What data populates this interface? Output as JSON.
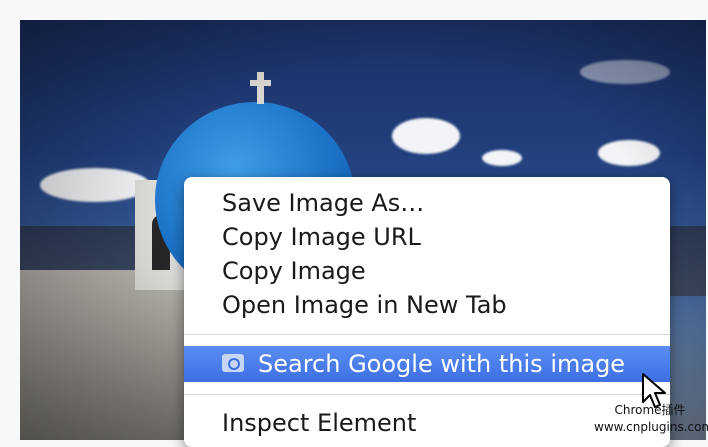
{
  "context_menu": {
    "items": [
      {
        "label": "Save Image As…"
      },
      {
        "label": "Copy Image URL"
      },
      {
        "label": "Copy Image"
      },
      {
        "label": "Open Image in New Tab"
      }
    ],
    "highlighted_item": {
      "label": "Search Google with this image",
      "icon": "camera-icon"
    },
    "footer_item": {
      "label": "Inspect Element"
    },
    "highlight_color": "#3d6fe3"
  },
  "watermark": {
    "line1": "Chrome插件",
    "line2": "www.cnplugins.com"
  }
}
